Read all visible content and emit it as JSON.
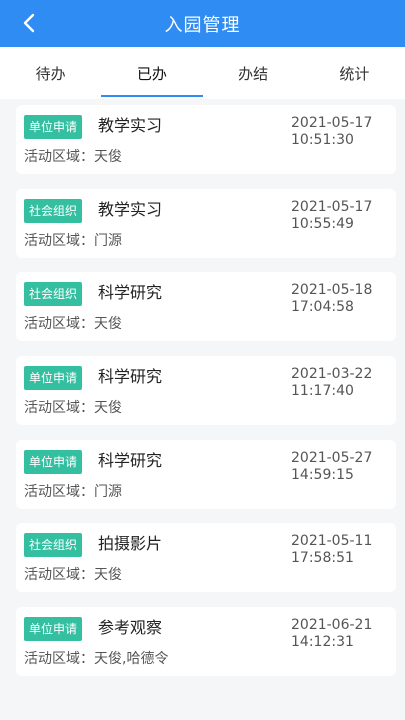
{
  "header": {
    "title": "入园管理",
    "back_icon": "chevron-left-icon"
  },
  "tabs": [
    {
      "label": "待办",
      "active": false
    },
    {
      "label": "已办",
      "active": true
    },
    {
      "label": "办结",
      "active": false
    },
    {
      "label": "统计",
      "active": false
    }
  ],
  "records": [
    {
      "badge": "单位申请",
      "title": "教学实习",
      "area": "活动区域：天俊",
      "date": "2021-05-17",
      "time": "10:51:30"
    },
    {
      "badge": "社会组织",
      "title": "教学实习",
      "area": "活动区域：门源",
      "date": "2021-05-17",
      "time": "10:55:49"
    },
    {
      "badge": "社会组织",
      "title": "科学研究",
      "area": "活动区域：天俊",
      "date": "2021-05-18",
      "time": "17:04:58"
    },
    {
      "badge": "单位申请",
      "title": "科学研究",
      "area": "活动区域：天俊",
      "date": "2021-03-22",
      "time": "11:17:40"
    },
    {
      "badge": "单位申请",
      "title": "科学研究",
      "area": "活动区域：门源",
      "date": "2021-05-27",
      "time": "14:59:15"
    },
    {
      "badge": "社会组织",
      "title": "拍摄影片",
      "area": "活动区域：天俊",
      "date": "2021-05-11",
      "time": "17:58:51"
    },
    {
      "badge": "单位申请",
      "title": "参考观察",
      "area": "活动区域：天俊,哈德令",
      "date": "2021-06-21",
      "time": "14:12:31"
    }
  ],
  "colors": {
    "header": "#2f8cf2",
    "badge": "#33bfa0",
    "background": "#f5f6f8"
  }
}
